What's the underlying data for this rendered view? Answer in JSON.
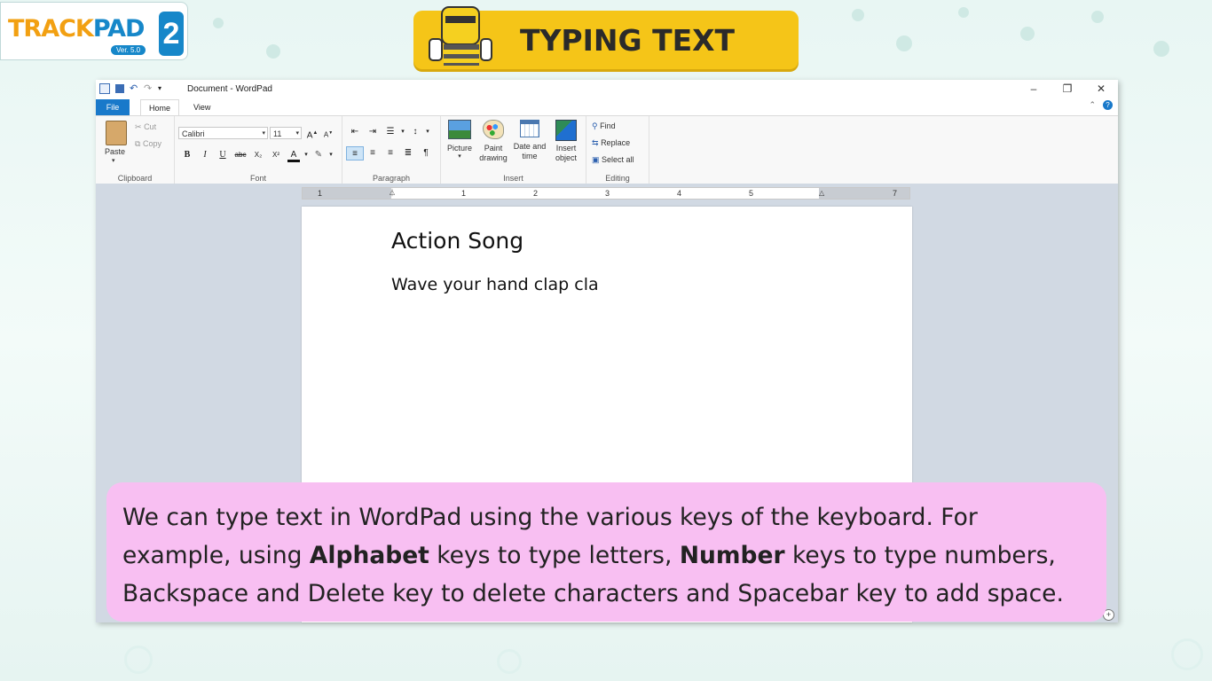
{
  "logo": {
    "brand_left": "TRACK",
    "brand_right": "PAD",
    "badge": "2",
    "version": "Ver. 5.0"
  },
  "banner": {
    "title": "TYPING TEXT"
  },
  "window": {
    "title": "Document - WordPad",
    "tabs": {
      "file": "File",
      "home": "Home",
      "view": "View"
    },
    "clipboard": {
      "paste": "Paste",
      "cut": "Cut",
      "copy": "Copy",
      "label": "Clipboard"
    },
    "font": {
      "family": "Calibri",
      "size": "11",
      "label": "Font",
      "buttons": {
        "bold": "B",
        "italic": "I",
        "underline": "U",
        "strike": "abc",
        "sub": "X₂",
        "sup": "X²",
        "color": "A"
      }
    },
    "paragraph": {
      "label": "Paragraph"
    },
    "insert": {
      "picture": "Picture",
      "paint": "Paint drawing",
      "datetime": "Date and time",
      "object": "Insert object",
      "label": "Insert"
    },
    "editing": {
      "find": "Find",
      "replace": "Replace",
      "select_all": "Select all",
      "label": "Editing"
    },
    "ruler": {
      "marks": [
        "1",
        "1",
        "2",
        "3",
        "4",
        "5",
        "7"
      ]
    },
    "document": {
      "heading": "Action Song",
      "body": "Wave your hand clap cla"
    }
  },
  "caption": {
    "part1": "We can type text in WordPad using the various keys of the keyboard. For example, using ",
    "bold1": "Alphabet",
    "part2": " keys to type letters, ",
    "bold2": "Number",
    "part3": " keys to type numbers, Backspace and Delete key to delete characters and Spacebar key to add space."
  },
  "colors": {
    "banner": "#f5c518",
    "caption_bg": "#f8bff2",
    "file_tab": "#1979ca",
    "doc_bg": "#d1d9e3"
  }
}
